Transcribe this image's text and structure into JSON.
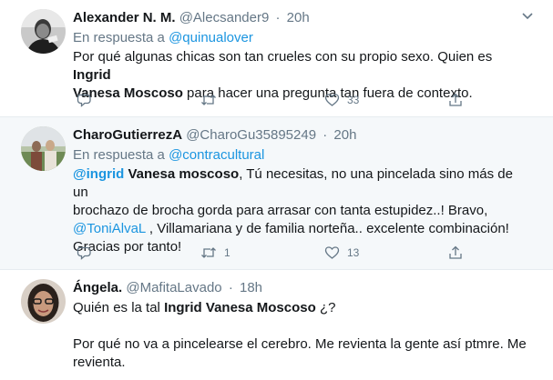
{
  "tweets": [
    {
      "name": "Alexander N. M.",
      "handle": "@Alecsander9",
      "time": "20h",
      "reply_prefix": "En respuesta a",
      "reply_user": "@quinualover",
      "lines": [
        [
          "Por qué algunas chicas son tan crueles con su propio sexo. Quien es ",
          "Ingrid"
        ],
        [
          "Vanesa Moscoso",
          " para hacer una pregunta tan fuera de contexto."
        ]
      ],
      "actions": {
        "reply": "",
        "retweet": "",
        "like": "33"
      }
    },
    {
      "name": "CharoGutierrezA",
      "handle": "@CharoGu35895249",
      "time": "20h",
      "reply_prefix": "En respuesta a",
      "reply_user": "@contracultural",
      "mention_ingrid": "@ingrid",
      "ingrid_rest": " Vanesa moscoso",
      "line1_rest": ", Tú necesitas, no una pincelada sino  más de un",
      "line2": "brochazo de brocha gorda para arrasar con tanta estupidez..! Bravo,",
      "mention_toni": "@ToniAlvaL",
      "line3_rest": " , Villamariana y de familia norteña.. excelente combinación!",
      "line4": "Gracias por tanto!",
      "actions": {
        "reply": "",
        "retweet": "1",
        "like": "13"
      }
    },
    {
      "name": "Ángela.",
      "handle": "@MafitaLavado",
      "time": "18h",
      "line1_a": "Quién es la tal ",
      "line1_b": "Ingrid Vanesa Moscoso",
      "line1_c": " ¿?",
      "line2": "Por qué no va a pincelearse el cerebro. Me revienta la gente así ptmre. Me",
      "line3": "revienta."
    }
  ],
  "dot": "·",
  "colors": {
    "link": "#1b95e0",
    "secondary": "#657786",
    "divider": "#e6ecf0",
    "hover_bg": "#f5f8fa"
  }
}
